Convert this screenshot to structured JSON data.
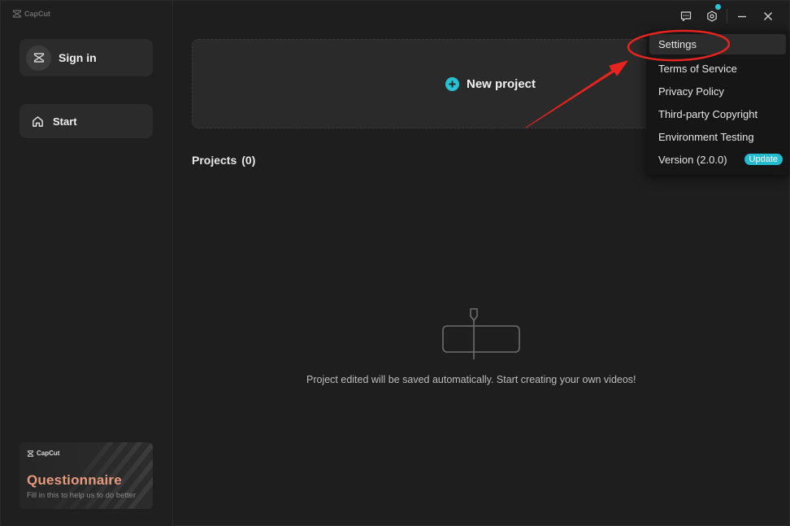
{
  "app": {
    "logo_text": "CapCut"
  },
  "sidebar": {
    "signin_label": "Sign in",
    "start_label": "Start",
    "questionnaire": {
      "brand": "CapCut",
      "title": "Questionnaire",
      "subtitle": "Fill in this to help us to do better"
    }
  },
  "main": {
    "new_project_label": "New project",
    "projects_label": "Projects",
    "projects_count": "(0)",
    "empty_message": "Project edited will be saved automatically. Start creating your own videos!"
  },
  "menu": {
    "items": [
      {
        "label": "Settings"
      },
      {
        "label": "Terms of Service"
      },
      {
        "label": "Privacy Policy"
      },
      {
        "label": "Third-party Copyright"
      },
      {
        "label": "Environment Testing"
      },
      {
        "label": "Version (2.0.0)"
      }
    ],
    "update_badge": "Update"
  },
  "icons": {
    "feedback": "feedback-icon",
    "settings": "gear-icon",
    "minimize": "minimize-icon",
    "close": "close-icon",
    "home": "home-icon",
    "plus": "plus-icon"
  },
  "colors": {
    "accent": "#26c2d2",
    "annotation_red": "#e8241e",
    "questionnaire_title": "#e79a7e"
  }
}
